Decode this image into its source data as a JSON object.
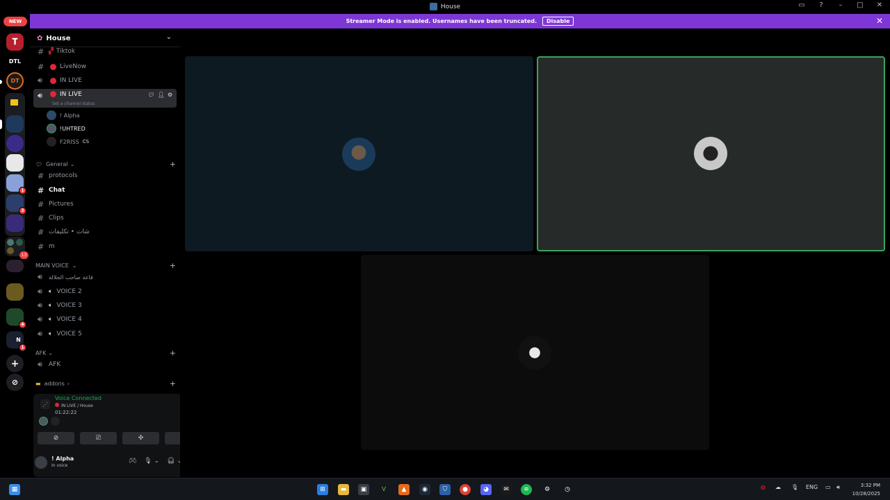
{
  "window": {
    "title": "House"
  },
  "new_badge": "NEW",
  "banner": {
    "text": "Streamer Mode is enabled. Usernames have been truncated.",
    "button": "Disable"
  },
  "guilds": [
    {
      "label": "",
      "color": "#b5202c"
    },
    {
      "label": "DTL",
      "color": "#000000"
    },
    {
      "label": "DT",
      "color": "#1a1a1a"
    },
    {
      "label": "",
      "color": "#3a2f08"
    },
    {
      "label": "",
      "color": "#1d3a5c"
    },
    {
      "label": "",
      "color": "#3b2a8a"
    },
    {
      "label": "",
      "color": "#e8e8e8"
    },
    {
      "label": "",
      "color": "#8aa0d8",
      "badge": "1"
    },
    {
      "label": "",
      "color": "#2c3f6b",
      "badge": "3"
    },
    {
      "label": "",
      "color": "#3a2a7a"
    },
    {
      "label": "",
      "color": "#1f3a2a",
      "badge": "13"
    },
    {
      "label": "",
      "color": "#2a2030"
    },
    {
      "label": "",
      "color": "#6b5a20"
    },
    {
      "label": "",
      "color": "#1f4a2a",
      "badge": "4"
    },
    {
      "label": "N",
      "color": "#1a2030",
      "badge": "1"
    }
  ],
  "server": {
    "name": "House"
  },
  "channels": {
    "tiktok": "Tiktok",
    "livenow": "LiveNow",
    "inlive_voice": "IN LIVE",
    "inlive_active": "IN LIVE",
    "set_status": "Set a channel status",
    "voice_users": [
      {
        "name": "! Alpha",
        "tag": ""
      },
      {
        "name": "!UHTRED",
        "tag": ""
      },
      {
        "name": "F2RISS",
        "tag": "CS"
      }
    ],
    "general_cat": "General",
    "text": [
      "protocols",
      "Chat",
      "Pictures",
      "Clips",
      "شات • تكليفات",
      "m"
    ],
    "main_voice_cat": "MAIN VOICE",
    "lounge": "قاعة صاحب الجلالة",
    "voices": [
      "VOICE 2",
      "VOICE 3",
      "VOICE 4",
      "VOICE 5"
    ],
    "afk_cat": "AFK",
    "afk": "AFK",
    "addons_cat": "addons"
  },
  "voice_panel": {
    "status": "Voice Connected",
    "channel": "IN LIVE / House",
    "elapsed": "01:22:22"
  },
  "user": {
    "name": "! Alpha",
    "status": "In voice"
  },
  "tray": {
    "lang": "ENG",
    "time": "3:32 PM",
    "date": "10/28/2025"
  }
}
